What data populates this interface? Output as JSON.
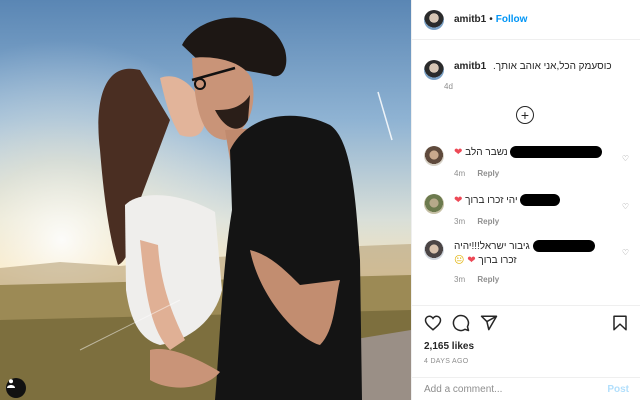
{
  "post": {
    "username": "amitb1",
    "separator": "•",
    "follow_label": "Follow",
    "caption": "כוסעמק הכל,אני אוהב אותך.",
    "caption_age": "4d",
    "load_more_icon": "plus-circle-icon"
  },
  "comments": [
    {
      "text": "נשבר הלב",
      "emoji": "❤",
      "age": "4m",
      "reply_label": "Reply"
    },
    {
      "text": "יהי זכרו ברוך",
      "emoji": "❤",
      "age": "3m",
      "reply_label": "Reply"
    },
    {
      "line1": "גיבור ישראל!!!יהיה",
      "line2": "זכרו ברוך",
      "emoji1": "❤",
      "emoji2": "😐",
      "age": "3m",
      "reply_label": "Reply"
    }
  ],
  "actions": {
    "icons": [
      "heart-icon",
      "comment-icon",
      "share-icon",
      "bookmark-icon"
    ],
    "likes": "2,165 likes",
    "date": "4 DAYS AGO"
  },
  "composer": {
    "placeholder": "Add a comment...",
    "post_label": "Post"
  },
  "colors": {
    "follow": "#0095f6",
    "post_disabled": "#b2dffc",
    "heart_red": "#ed4956",
    "muted": "#8e8e8e"
  }
}
